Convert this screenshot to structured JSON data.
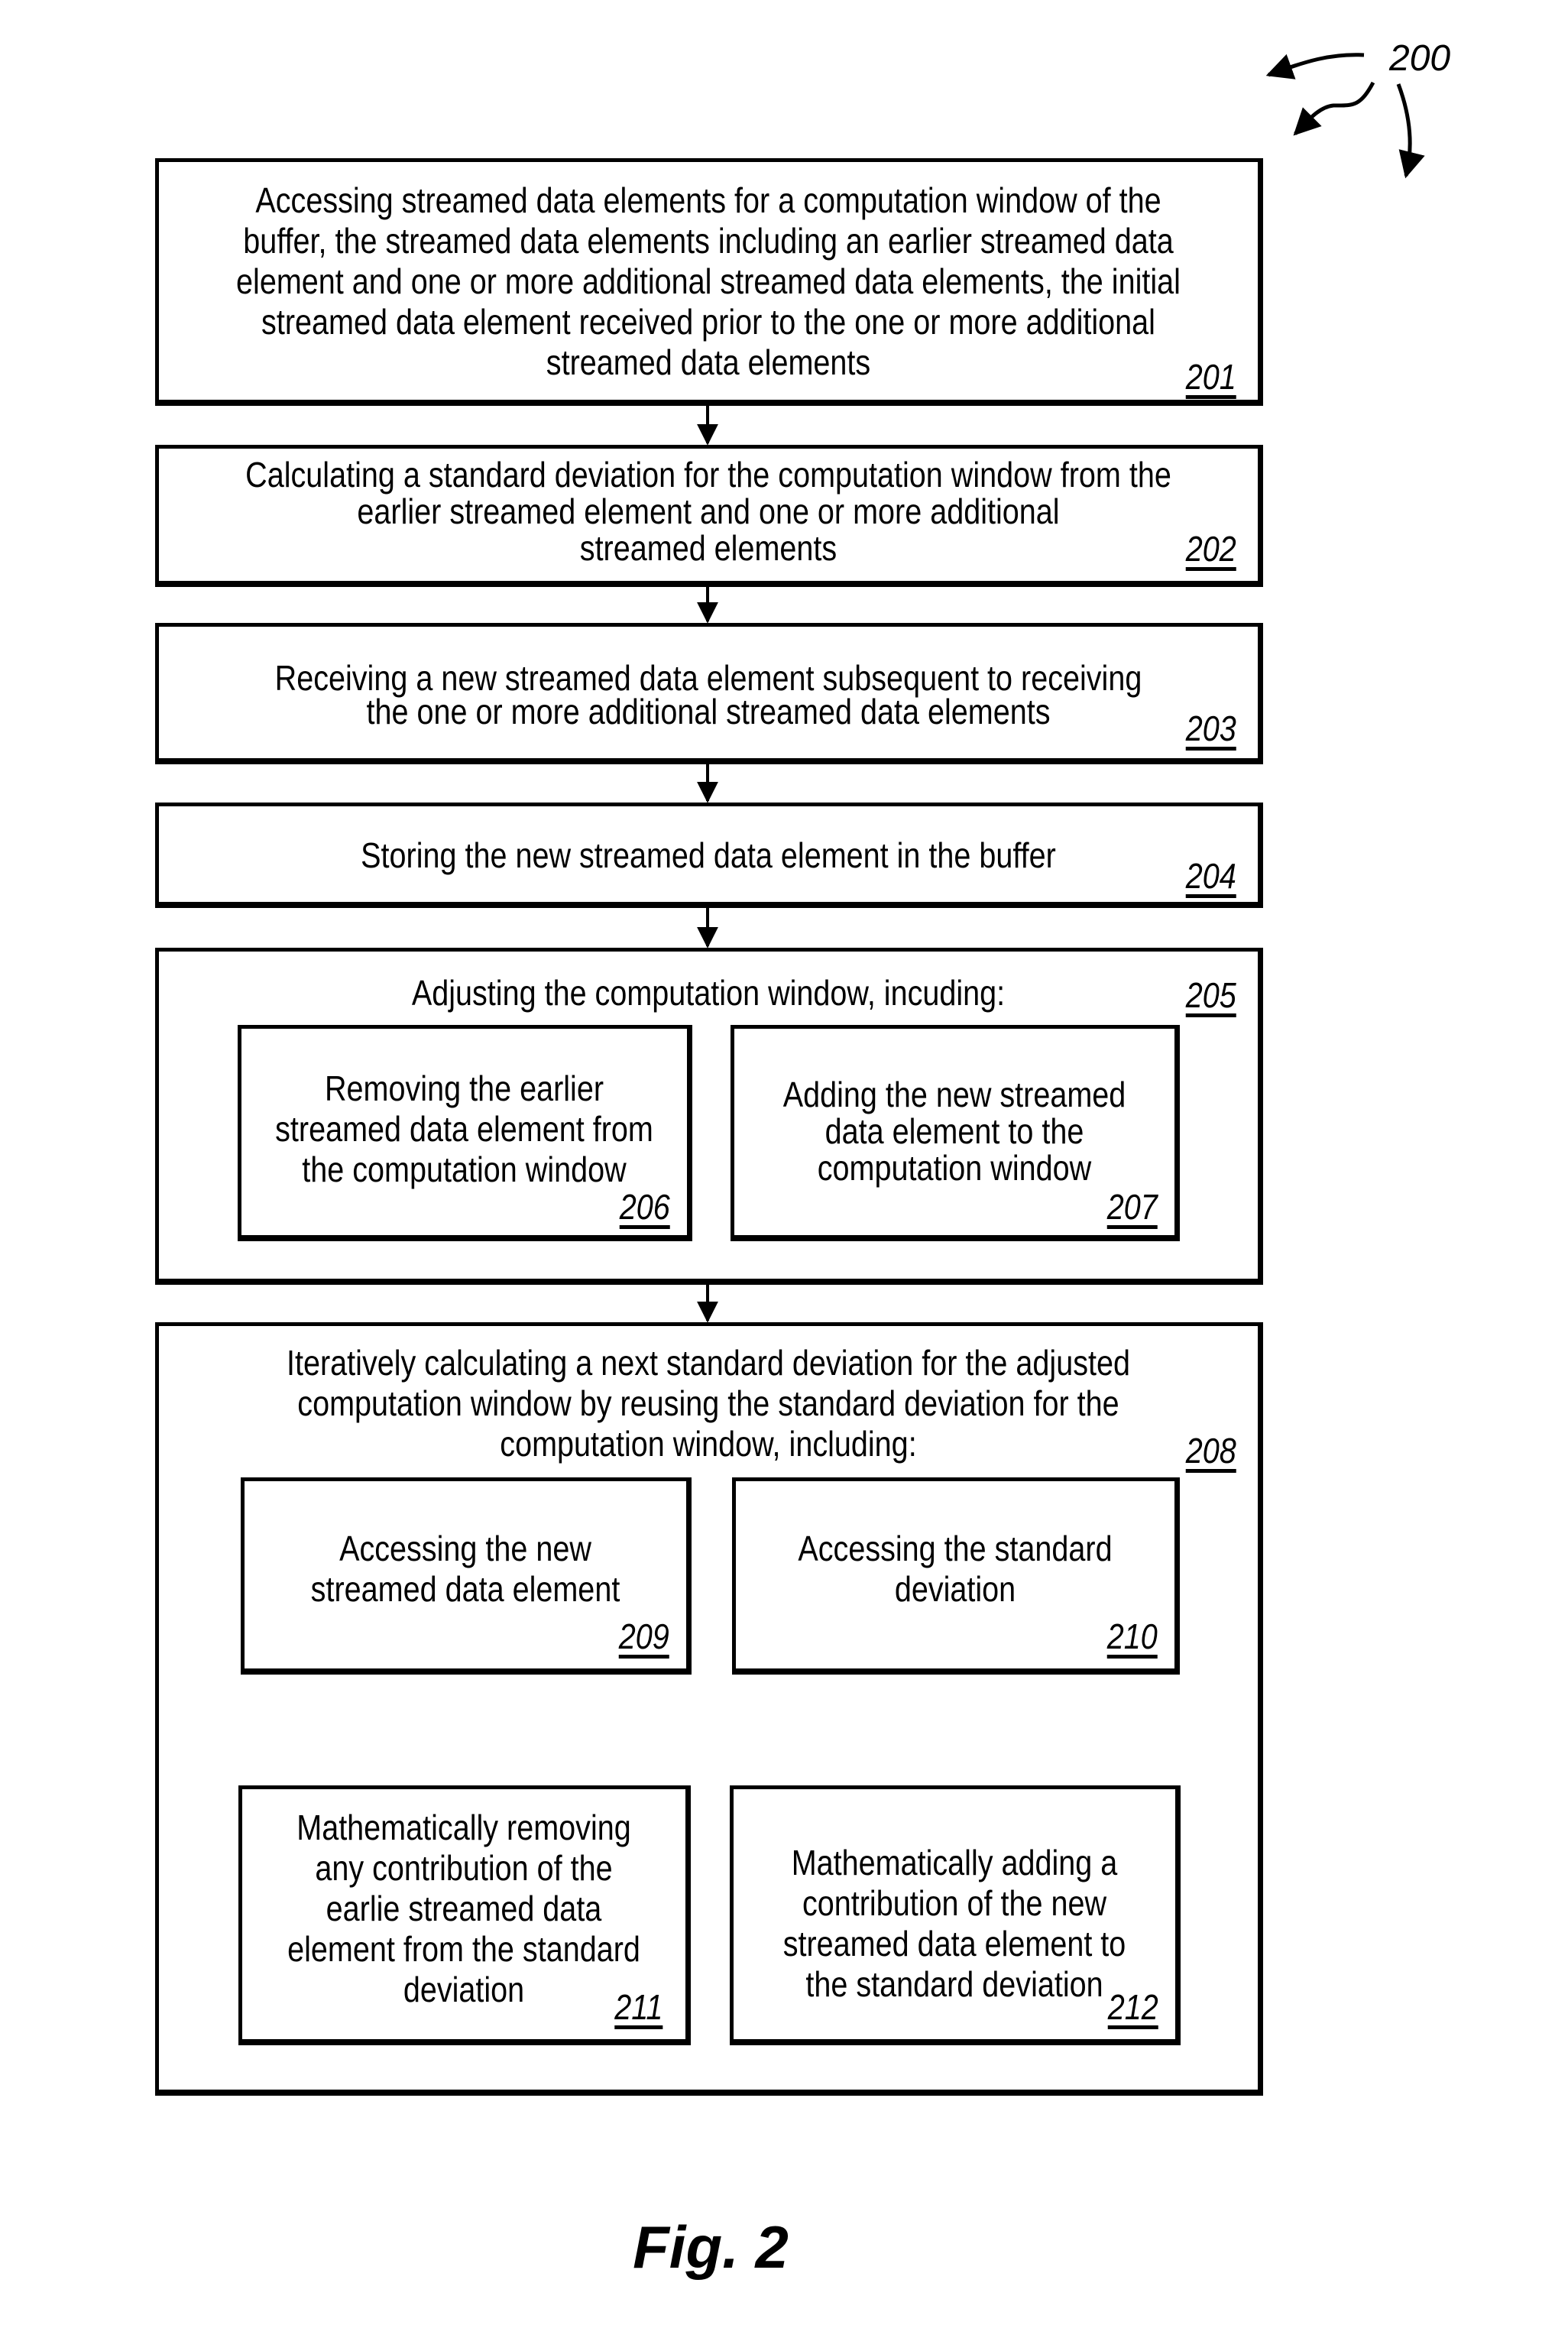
{
  "figure": {
    "reference_numeral": "200",
    "caption": "Fig. 2"
  },
  "steps": {
    "s201": {
      "ref": "201",
      "text": "Accessing streamed data elements for a computation window of the\nbuffer, the streamed data elements including an earlier streamed data\nelement and one or more additional streamed data elements, the initial\nstreamed data element received prior to the one or more additional\nstreamed data elements"
    },
    "s202": {
      "ref": "202",
      "text": "Calculating a standard deviation for the computation window from the\nearlier streamed element and one or more additional\nstreamed elements"
    },
    "s203": {
      "ref": "203",
      "text": "Receiving a new streamed data element subsequent to receiving\nthe one or more additional streamed data elements"
    },
    "s204": {
      "ref": "204",
      "text": "Storing the new streamed data element in the buffer"
    },
    "s205": {
      "ref": "205",
      "text": "Adjusting the computation window, incuding:"
    },
    "s206": {
      "ref": "206",
      "text": "Removing the earlier\nstreamed data element from\nthe computation window"
    },
    "s207": {
      "ref": "207",
      "text": "Adding the new streamed\ndata element to the\ncomputation window"
    },
    "s208": {
      "ref": "208",
      "text": "Iteratively calculating a next standard deviation for the adjusted\ncomputation window by reusing the standard deviation for the\ncomputation window, including:"
    },
    "s209": {
      "ref": "209",
      "text": "Accessing the new\nstreamed data element"
    },
    "s210": {
      "ref": "210",
      "text": "Accessing the standard\ndeviation"
    },
    "s211": {
      "ref": "211",
      "text": "Mathematically removing\nany contribution of the\nearlie streamed data\nelement from the standard\ndeviation"
    },
    "s212": {
      "ref": "212",
      "text": "Mathematically adding a\ncontribution of the new\nstreamed data element to\nthe standard deviation"
    }
  }
}
